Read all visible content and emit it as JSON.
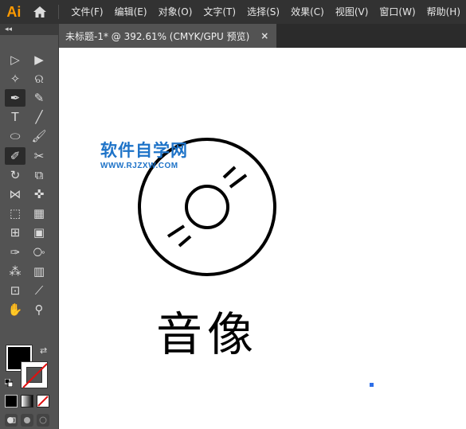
{
  "app": {
    "logo": "Ai",
    "menu": [
      "文件(F)",
      "编辑(E)",
      "对象(O)",
      "文字(T)",
      "选择(S)",
      "效果(C)",
      "视图(V)",
      "窗口(W)",
      "帮助(H)"
    ]
  },
  "document_tab": {
    "label": "未标题-1* @ 392.61% (CMYK/GPU 预览)",
    "close": "×"
  },
  "toolbar": {
    "collapse": "◂◂",
    "tools": [
      {
        "name": "selection-tool-icon",
        "glyph": "▷"
      },
      {
        "name": "direct-selection-tool-icon",
        "glyph": "▶"
      },
      {
        "name": "magic-wand-tool-icon",
        "glyph": "✧"
      },
      {
        "name": "lasso-tool-icon",
        "glyph": "ର"
      },
      {
        "name": "pen-tool-icon",
        "glyph": "✒"
      },
      {
        "name": "curvature-tool-icon",
        "glyph": "✎"
      },
      {
        "name": "type-tool-icon",
        "glyph": "T"
      },
      {
        "name": "line-segment-tool-icon",
        "glyph": "╱"
      },
      {
        "name": "ellipse-tool-icon",
        "glyph": "⬭"
      },
      {
        "name": "paintbrush-tool-icon",
        "glyph": "🖌"
      },
      {
        "name": "shaper-tool-icon",
        "glyph": "✐"
      },
      {
        "name": "scissors-tool-icon",
        "glyph": "✂"
      },
      {
        "name": "rotate-tool-icon",
        "glyph": "↻"
      },
      {
        "name": "scale-tool-icon",
        "glyph": "⧉"
      },
      {
        "name": "width-tool-icon",
        "glyph": "⋈"
      },
      {
        "name": "puppet-warp-tool-icon",
        "glyph": "✜"
      },
      {
        "name": "free-transform-tool-icon",
        "glyph": "⬚"
      },
      {
        "name": "perspective-grid-tool-icon",
        "glyph": "▦"
      },
      {
        "name": "mesh-tool-icon",
        "glyph": "⊞"
      },
      {
        "name": "gradient-tool-icon",
        "glyph": "▣"
      },
      {
        "name": "eyedropper-tool-icon",
        "glyph": "✑"
      },
      {
        "name": "blend-tool-icon",
        "glyph": "⧂"
      },
      {
        "name": "symbol-sprayer-tool-icon",
        "glyph": "⁂"
      },
      {
        "name": "column-graph-tool-icon",
        "glyph": "▥"
      },
      {
        "name": "artboard-tool-icon",
        "glyph": "⊡"
      },
      {
        "name": "slice-tool-icon",
        "glyph": "⟋"
      },
      {
        "name": "hand-tool-icon",
        "glyph": "✋"
      },
      {
        "name": "zoom-tool-icon",
        "glyph": "⚲"
      }
    ],
    "swap": "⇄"
  },
  "canvas": {
    "watermark_title": "软件自学网",
    "watermark_url": "WWW.RJZXW.COM",
    "caption": "音像"
  },
  "colors": {
    "menubar": "#323232",
    "panel": "#535353",
    "canvas": "#ffffff",
    "watermark": "#1e73c8",
    "logo": "#ff9a00",
    "anchor": "#2f6fe8"
  }
}
